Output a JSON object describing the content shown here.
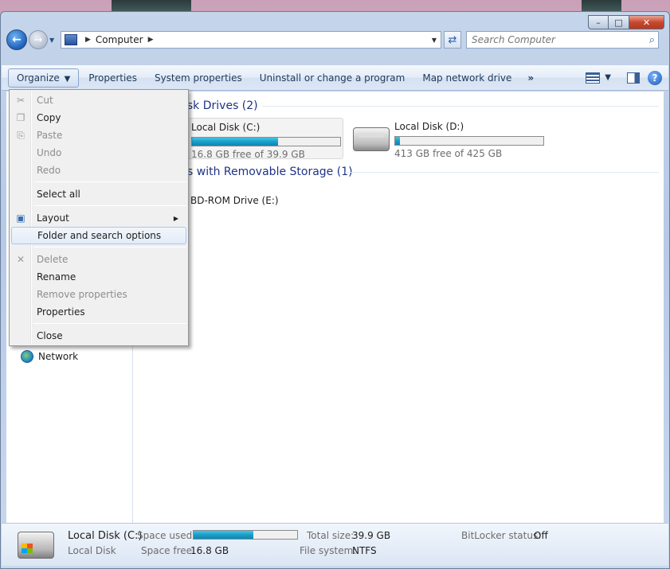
{
  "address": {
    "location": "Computer"
  },
  "search": {
    "placeholder": "Search Computer"
  },
  "commands": {
    "organize": "Organize",
    "properties": "Properties",
    "system_properties": "System properties",
    "uninstall": "Uninstall or change a program",
    "map_drive": "Map network drive",
    "more": "»"
  },
  "groups": {
    "hard_disk": "isk Drives (2)",
    "removable": "s with Removable Storage (1)"
  },
  "drives": [
    {
      "name": "Local Disk (C:)",
      "free_text": "16.8 GB free of 39.9 GB",
      "used_fraction": 0.58
    },
    {
      "name": "Local Disk (D:)",
      "free_text": "413 GB free of 425 GB",
      "used_fraction": 0.03
    }
  ],
  "removable_drive": {
    "name": "BD-ROM Drive (E:)"
  },
  "nav": {
    "network": "Network"
  },
  "menu": {
    "cut": "Cut",
    "copy": "Copy",
    "paste": "Paste",
    "undo": "Undo",
    "redo": "Redo",
    "select_all": "Select all",
    "layout": "Layout",
    "folder_options": "Folder and search options",
    "delete": "Delete",
    "rename": "Rename",
    "remove_properties": "Remove properties",
    "properties": "Properties",
    "close": "Close"
  },
  "details": {
    "name": "Local Disk (C:)",
    "type": "Local Disk",
    "space_used_label": "Space used:",
    "space_free_label": "Space free:",
    "space_free": "16.8 GB",
    "total_size_label": "Total size:",
    "total_size": "39.9 GB",
    "file_system_label": "File system:",
    "file_system": "NTFS",
    "bitlocker_label": "BitLocker status:",
    "bitlocker": "Off",
    "used_fraction": 0.58
  },
  "colors": {
    "accent": "#1e3287",
    "progress": "#1a9ec9"
  }
}
